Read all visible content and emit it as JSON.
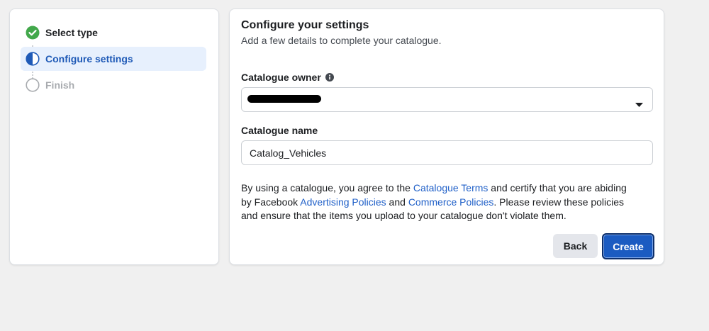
{
  "steps": [
    {
      "label": "Select type",
      "status": "complete",
      "icon": "check-circle-icon"
    },
    {
      "label": "Configure settings",
      "status": "active",
      "icon": "half-circle-icon"
    },
    {
      "label": "Finish",
      "status": "pending",
      "icon": "empty-circle-icon"
    }
  ],
  "main": {
    "title": "Configure your settings",
    "subtitle": "Add a few details to complete your catalogue.",
    "owner_label": "Catalogue owner",
    "name_label": "Catalogue name",
    "name_value": "Catalog_Vehicles",
    "terms": {
      "t1": "By using a catalogue, you agree to the ",
      "link1": "Catalogue Terms",
      "t2": " and certify that you are abiding by Facebook ",
      "link2": "Advertising Policies",
      "t3": " and ",
      "link3": "Commerce Policies",
      "t4": ". Please review these policies and ensure that the items you upload to your catalogue don't violate them."
    }
  },
  "buttons": {
    "back": "Back",
    "create": "Create"
  },
  "colors": {
    "accent": "#1b5bc1",
    "success": "#42a84b",
    "link": "#2060c8"
  }
}
